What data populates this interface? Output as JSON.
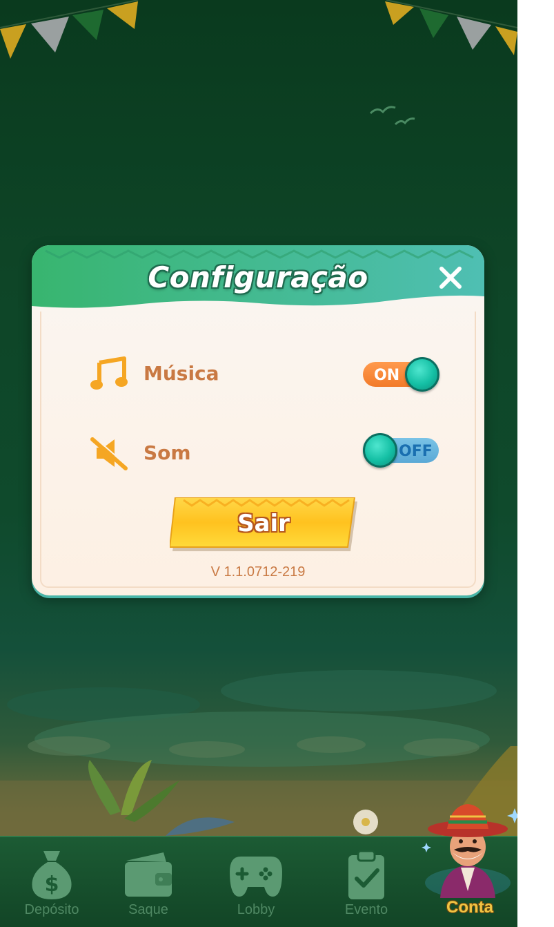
{
  "modal": {
    "title": "Configuração",
    "close_icon": "close-icon",
    "settings": [
      {
        "label": "Música",
        "icon": "music-note-icon",
        "state": "ON"
      },
      {
        "label": "Som",
        "icon": "sound-muted-icon",
        "state": "OFF"
      }
    ],
    "exit_label": "Sair",
    "version": "V 1.1.0712-219"
  },
  "bottom_nav": {
    "items": [
      {
        "label": "Depósito",
        "icon": "money-bag-icon"
      },
      {
        "label": "Saque",
        "icon": "wallet-icon"
      },
      {
        "label": "Lobby",
        "icon": "gamepad-icon"
      },
      {
        "label": "Evento",
        "icon": "clipboard-check-icon"
      },
      {
        "label": "Conta",
        "icon": "avatar-mascot-icon"
      }
    ],
    "active": "Conta"
  },
  "colors": {
    "background": "#0e4527",
    "modal_header": "#3fb98c",
    "label_orange": "#c97943",
    "toggle_on": "#f27b2a",
    "toggle_off": "#5aa9d6",
    "knob": "#14bfa4",
    "exit_button": "#fcc92a",
    "nav_active": "#f0c443"
  }
}
